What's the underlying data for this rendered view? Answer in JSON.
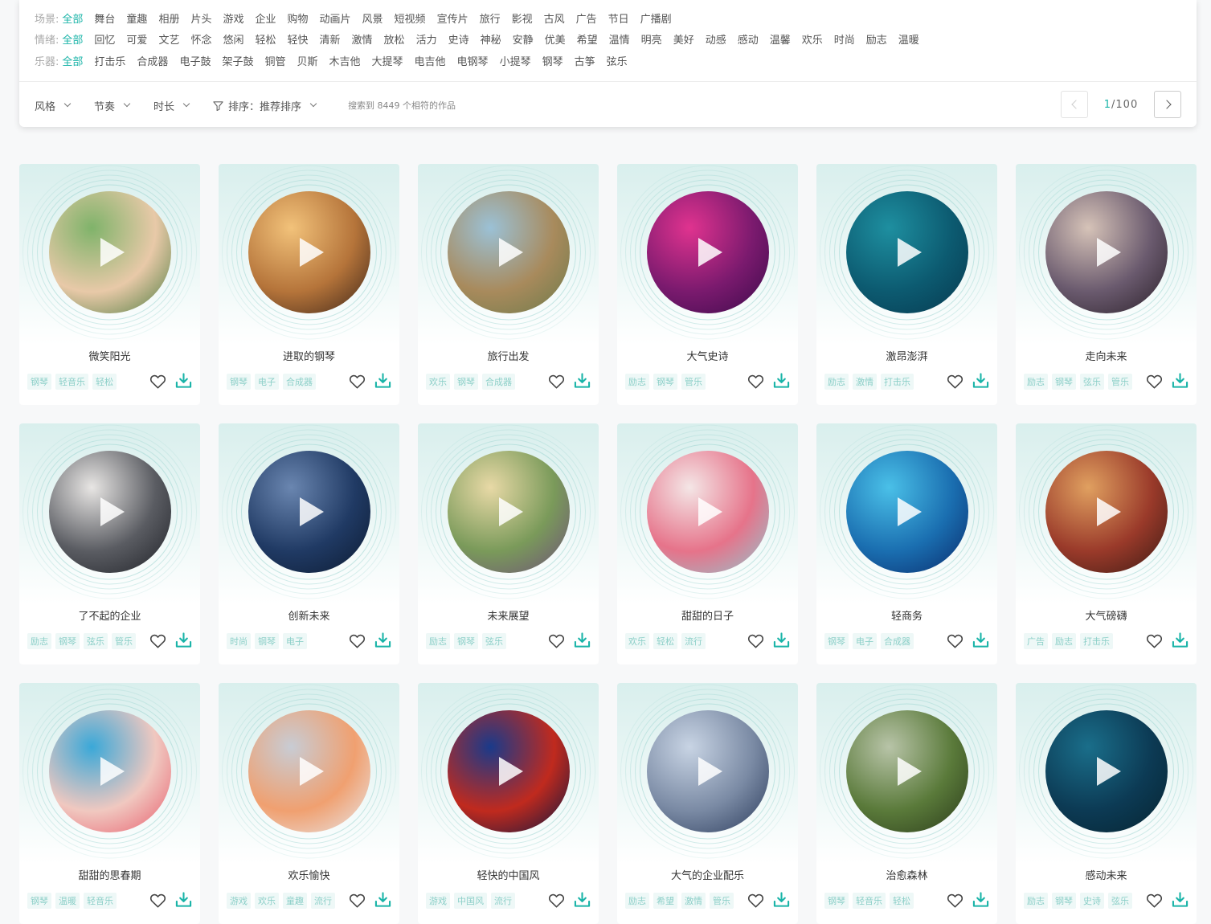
{
  "filters": {
    "scene": {
      "label": "场景:",
      "options": [
        "全部",
        "舞台",
        "童趣",
        "相册",
        "片头",
        "游戏",
        "企业",
        "购物",
        "动画片",
        "风景",
        "短视频",
        "宣传片",
        "旅行",
        "影视",
        "古风",
        "广告",
        "节日",
        "广播剧"
      ]
    },
    "mood": {
      "label": "情绪:",
      "options": [
        "全部",
        "回忆",
        "可爱",
        "文艺",
        "怀念",
        "悠闲",
        "轻松",
        "轻快",
        "清新",
        "激情",
        "放松",
        "活力",
        "史诗",
        "神秘",
        "安静",
        "优美",
        "希望",
        "温情",
        "明亮",
        "美好",
        "动感",
        "感动",
        "温馨",
        "欢乐",
        "时尚",
        "励志",
        "温暖"
      ]
    },
    "instrument": {
      "label": "乐器:",
      "options": [
        "全部",
        "打击乐",
        "合成器",
        "电子鼓",
        "架子鼓",
        "铜管",
        "贝斯",
        "木吉他",
        "大提琴",
        "电吉他",
        "电钢琴",
        "小提琴",
        "钢琴",
        "古筝",
        "弦乐"
      ]
    }
  },
  "sortbar": {
    "style": "风格",
    "tempo": "节奏",
    "duration": "时长",
    "sort": "排序：推荐排序",
    "result": "搜索到 8449 个相符的作品"
  },
  "pager": {
    "current": "1",
    "total": "/100"
  },
  "colors": {
    "accent": "#1ab4a8",
    "tag_text": "#8ccfc8"
  },
  "cards": [
    {
      "title": "微笑阳光",
      "tags": [
        "钢琴",
        "轻音乐",
        "轻松"
      ],
      "art": [
        "#7fb36a",
        "#e8c9a8",
        "#4a7a3d"
      ]
    },
    {
      "title": "进取的钢琴",
      "tags": [
        "钢琴",
        "电子",
        "合成器"
      ],
      "art": [
        "#f2c27a",
        "#b5743a",
        "#3b2418"
      ]
    },
    {
      "title": "旅行出发",
      "tags": [
        "欢乐",
        "钢琴",
        "合成器"
      ],
      "art": [
        "#9bc1d6",
        "#a88a5c",
        "#6b7a4a"
      ]
    },
    {
      "title": "大气史诗",
      "tags": [
        "励志",
        "钢琴",
        "管乐"
      ],
      "art": [
        "#e0338f",
        "#7a1a6e",
        "#3b0a4a"
      ]
    },
    {
      "title": "激昂澎湃",
      "tags": [
        "励志",
        "激情",
        "打击乐"
      ],
      "art": [
        "#1e8fa0",
        "#0c5a70",
        "#07384e"
      ]
    },
    {
      "title": "走向未来",
      "tags": [
        "励志",
        "钢琴",
        "弦乐",
        "管乐"
      ],
      "art": [
        "#d6c3b8",
        "#6a5a6e",
        "#2a1f28"
      ]
    },
    {
      "title": "了不起的企业",
      "tags": [
        "励志",
        "钢琴",
        "弦乐",
        "管乐"
      ],
      "art": [
        "#e8e6e4",
        "#5a5c62",
        "#1e2026"
      ]
    },
    {
      "title": "创新未来",
      "tags": [
        "时尚",
        "钢琴",
        "电子"
      ],
      "art": [
        "#6a86b0",
        "#203a64",
        "#0c1a30"
      ]
    },
    {
      "title": "未来展望",
      "tags": [
        "励志",
        "钢琴",
        "弦乐"
      ],
      "art": [
        "#e8d9a6",
        "#7a9a5a",
        "#6e4f7a"
      ]
    },
    {
      "title": "甜甜的日子",
      "tags": [
        "欢乐",
        "轻松",
        "流行"
      ],
      "art": [
        "#f4e6e6",
        "#e6738a",
        "#8ec8d0"
      ]
    },
    {
      "title": "轻商务",
      "tags": [
        "钢琴",
        "电子",
        "合成器"
      ],
      "art": [
        "#4ac0e8",
        "#1a6eb0",
        "#0a2a6a"
      ]
    },
    {
      "title": "大气磅礴",
      "tags": [
        "广告",
        "励志",
        "打击乐"
      ],
      "art": [
        "#e0a060",
        "#9a3a2a",
        "#3a1a14"
      ]
    },
    {
      "title": "甜甜的思春期",
      "tags": [
        "钢琴",
        "温暖",
        "轻音乐"
      ],
      "art": [
        "#3aa8d8",
        "#f0c8c0",
        "#e85a6a"
      ]
    },
    {
      "title": "欢乐愉快",
      "tags": [
        "游戏",
        "欢乐",
        "童趣",
        "流行"
      ],
      "art": [
        "#c8ccd4",
        "#f0a070",
        "#e8e8ec"
      ]
    },
    {
      "title": "轻快的中国风",
      "tags": [
        "游戏",
        "中国风",
        "流行"
      ],
      "art": [
        "#1a3a8a",
        "#c02a1e",
        "#0a1640"
      ]
    },
    {
      "title": "大气的企业配乐",
      "tags": [
        "励志",
        "希望",
        "激情",
        "管乐"
      ],
      "art": [
        "#c8d4e4",
        "#7a8aa4",
        "#2a3a5a"
      ]
    },
    {
      "title": "治愈森林",
      "tags": [
        "钢琴",
        "轻音乐",
        "轻松"
      ],
      "art": [
        "#b8c4a8",
        "#5a7a3a",
        "#2a3a1a"
      ]
    },
    {
      "title": "感动未来",
      "tags": [
        "励志",
        "钢琴",
        "史诗",
        "弦乐"
      ],
      "art": [
        "#1a6e8a",
        "#0c3a54",
        "#062430"
      ]
    }
  ]
}
